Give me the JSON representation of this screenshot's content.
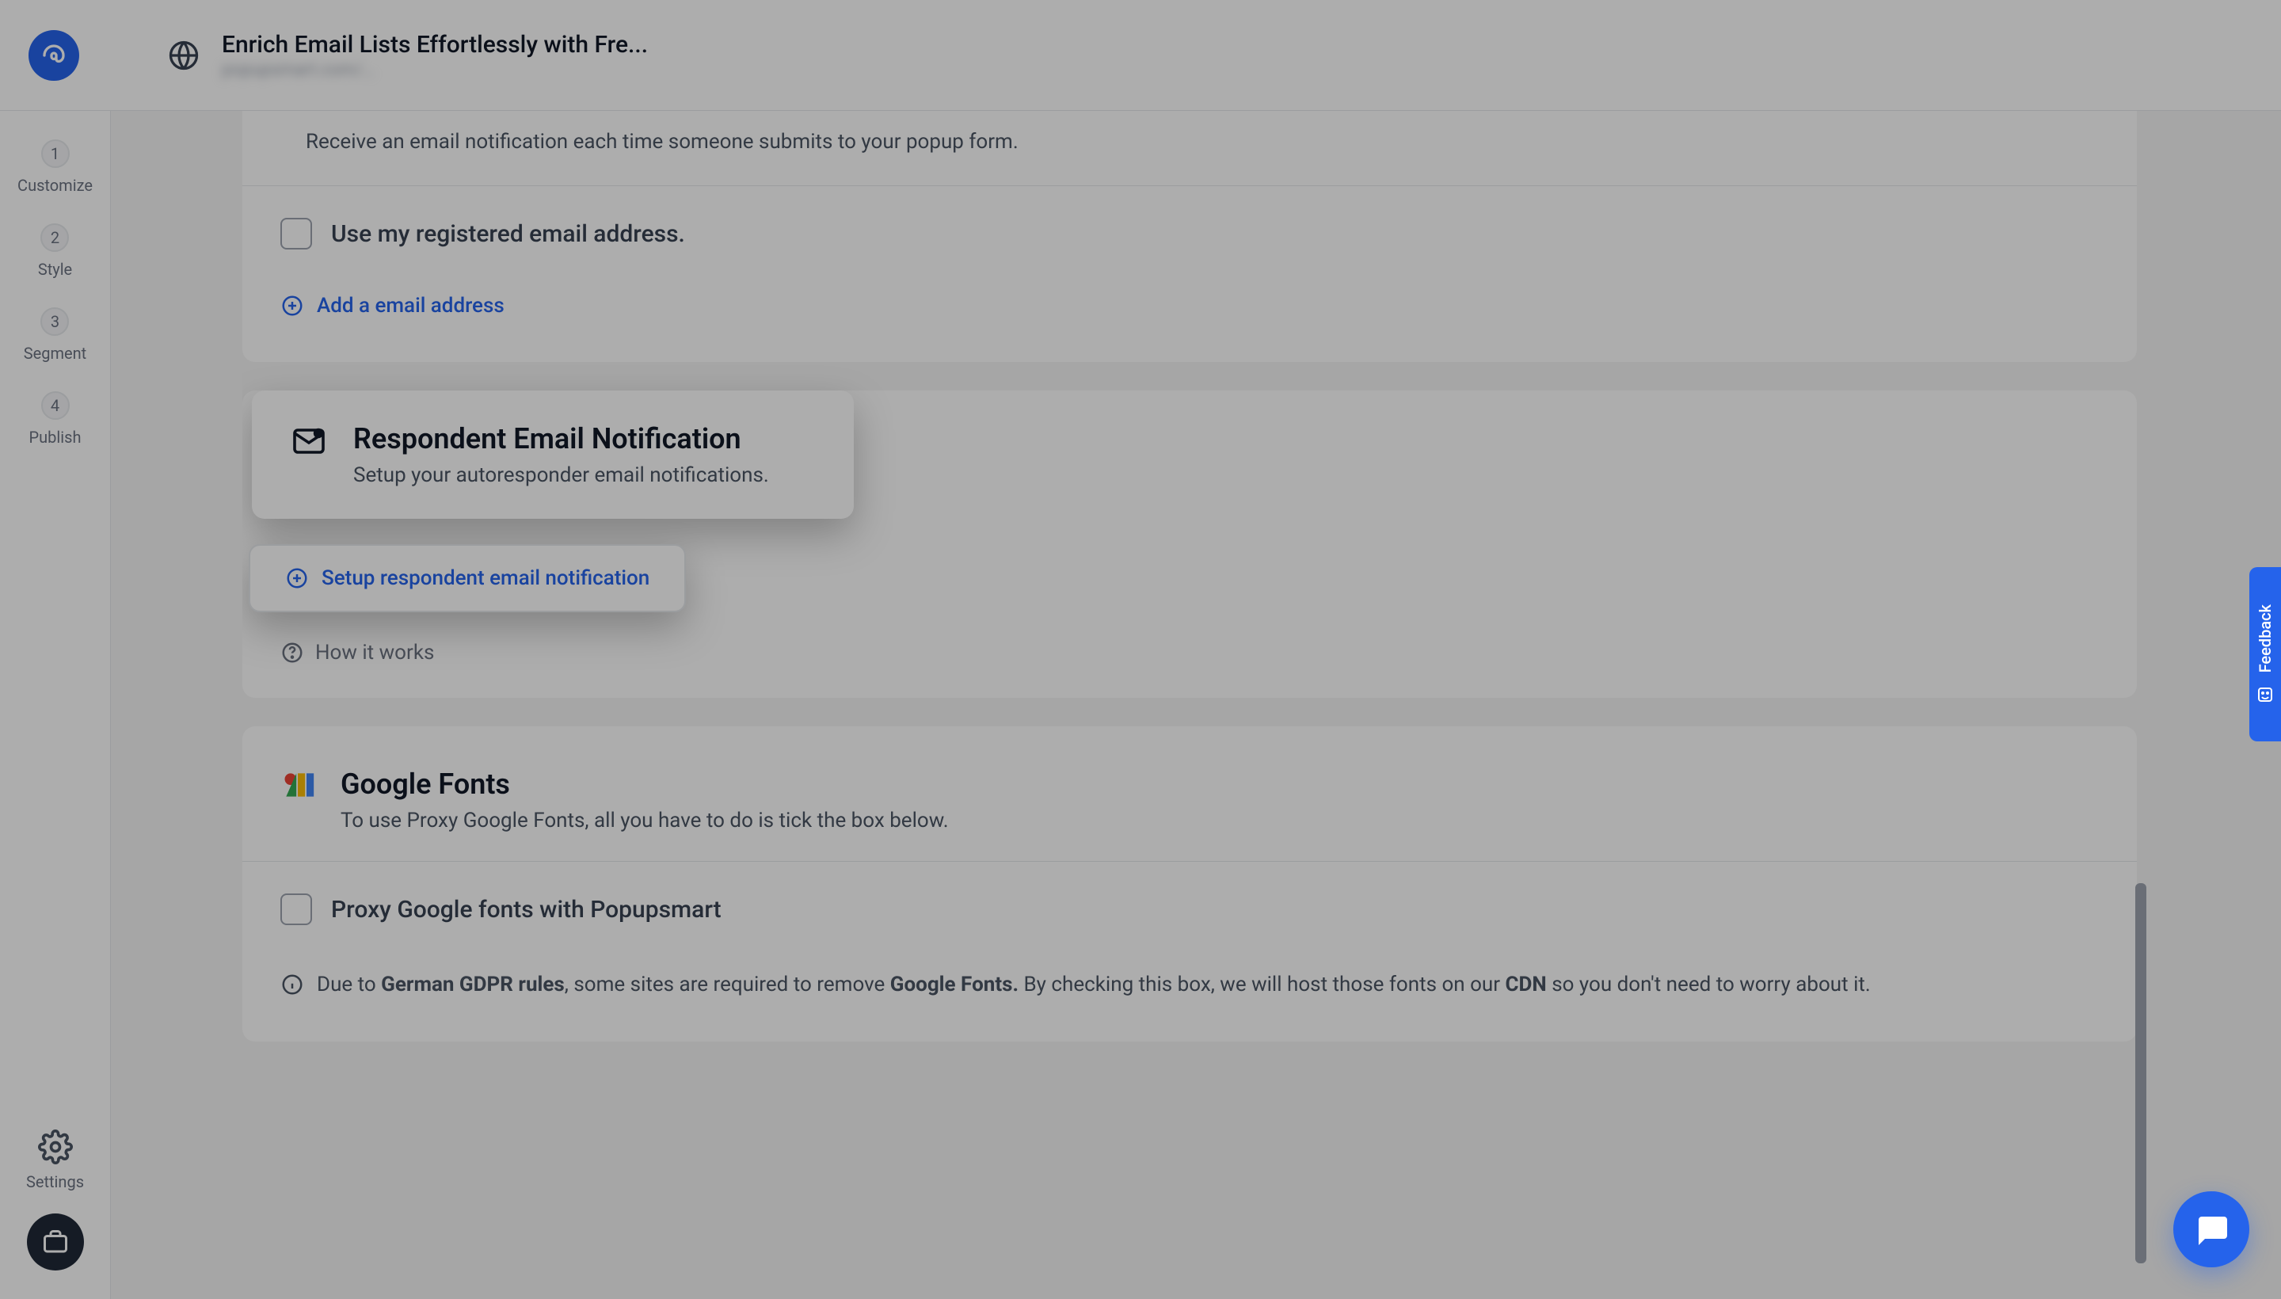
{
  "header": {
    "title": "Enrich Email Lists Effortlessly with Fre...",
    "subtitle": "popupsmart.com/…"
  },
  "rail_steps": [
    {
      "num": "1",
      "label": "Customize"
    },
    {
      "num": "2",
      "label": "Style"
    },
    {
      "num": "3",
      "label": "Segment"
    },
    {
      "num": "4",
      "label": "Publish"
    }
  ],
  "rail_bottom": {
    "settings": "Settings"
  },
  "card_notif_intro": {
    "body": "Receive an email notification each time someone submits to your popup form.",
    "checkbox_label": "Use my registered email address.",
    "add_link": "Add a email address"
  },
  "respondent": {
    "title": "Respondent Email Notification",
    "sub": "Setup your autoresponder email notifications.",
    "setup_btn": "Setup respondent email notification",
    "how": "How it works"
  },
  "fonts": {
    "title": "Google Fonts",
    "sub": "To use Proxy Google Fonts, all you have to do is tick the box below.",
    "checkbox_label": "Proxy Google fonts with Popupsmart",
    "gdpr_pre": "Due to ",
    "gdpr_bold1": "German GDPR rules",
    "gdpr_mid1": ", some sites are required to remove ",
    "gdpr_bold2": "Google Fonts.",
    "gdpr_mid2": " By checking this box, we will host those fonts on our ",
    "gdpr_bold3": "CDN",
    "gdpr_post": " so you don't need to worry about it."
  },
  "feedback": "Feedback"
}
